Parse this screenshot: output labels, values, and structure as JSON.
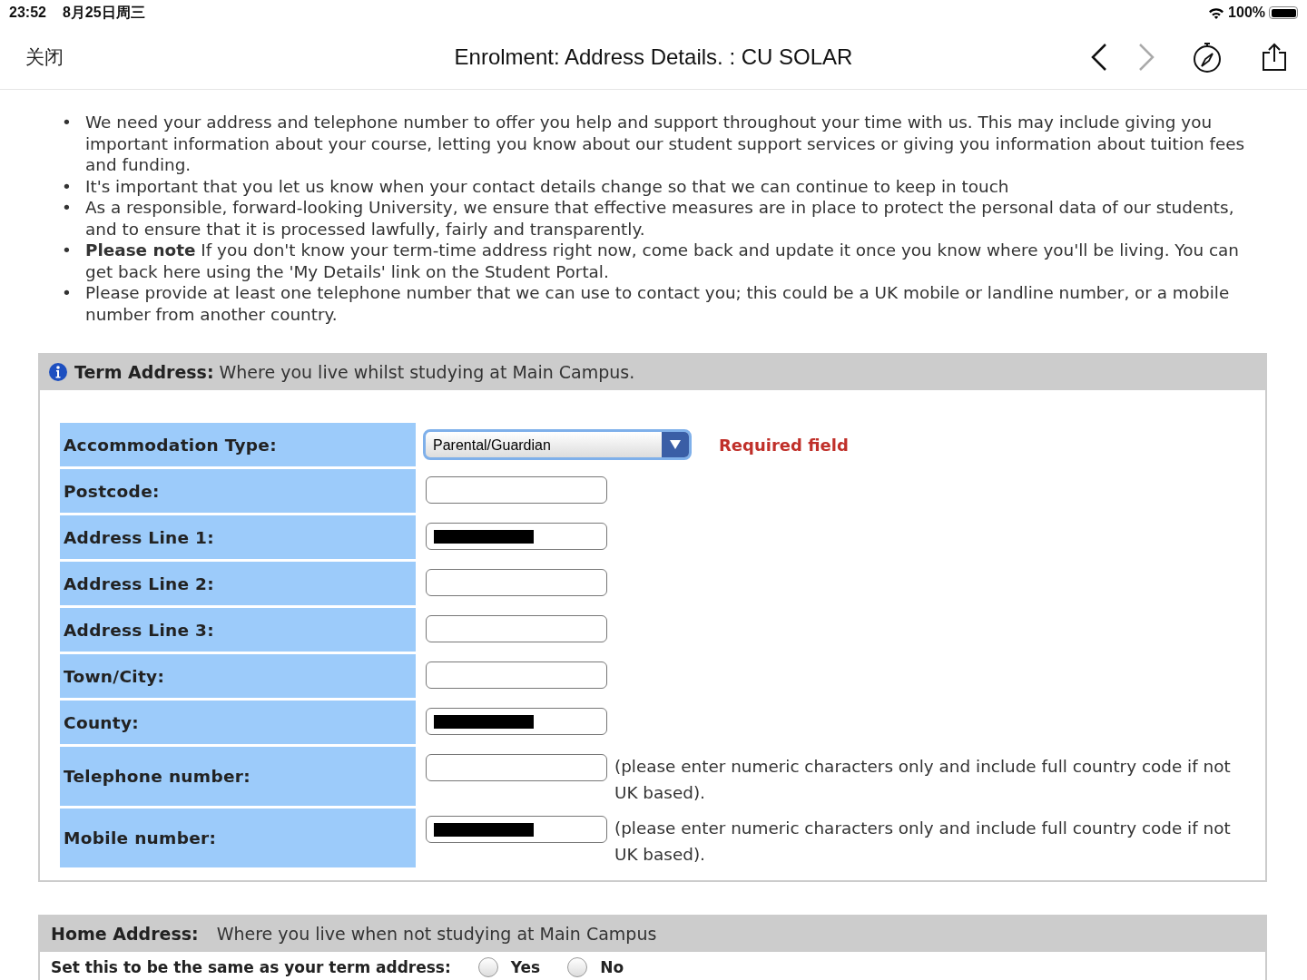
{
  "status_bar": {
    "time": "23:52",
    "date": "8月25日周三",
    "battery": "100%"
  },
  "nav": {
    "close": "关闭",
    "title": "Enrolment: Address Details. : CU SOLAR",
    "back_enabled": true,
    "forward_enabled": false
  },
  "bullets": [
    {
      "marker": "•",
      "text": "We need your address and telephone number to offer you help and support throughout your time with us. This may include giving you important information about your course, letting you know about our student support services or giving you information about tuition fees and funding."
    },
    {
      "marker": "•",
      "text": "It's important that you let us know when your contact details change so that we can continue to keep in touch"
    },
    {
      "marker": "•",
      "text": "As a responsible, forward-looking University, we ensure that effective measures are in place to protect the personal data of our students, and to ensure that it is processed lawfully, fairly and transparently."
    },
    {
      "marker": "•",
      "text": "**Please note** If you don't know your term-time address right now, come back and update it once you know where you'll be living. You can get back here using the 'My Details' link on the Student Portal."
    },
    {
      "marker": "•",
      "text": "Please provide at least one telephone number that we can use to contact you; this could be a UK mobile or landline number, or a mobile number from another country."
    }
  ],
  "term_address": {
    "title": "Term Address:",
    "subtitle": "Where you live whilst studying at Main Campus.",
    "rows": [
      {
        "kind": "select",
        "label": "Accommodation Type:",
        "value": "Parental/Guardian",
        "note": "Required field"
      },
      {
        "kind": "text",
        "label": "Postcode:",
        "redacted": false
      },
      {
        "kind": "text",
        "label": "Address Line 1:",
        "redacted": true
      },
      {
        "kind": "text",
        "label": "Address Line 2:",
        "redacted": false
      },
      {
        "kind": "text",
        "label": "Address Line 3:",
        "redacted": false
      },
      {
        "kind": "text",
        "label": "Town/City:",
        "redacted": false
      },
      {
        "kind": "text",
        "label": "County:",
        "redacted": true
      },
      {
        "kind": "text",
        "label": "Telephone number:",
        "redacted": false,
        "hint": "(please enter numeric characters only and include full country code if not UK based)."
      },
      {
        "kind": "text",
        "label": "Mobile number:",
        "redacted": true,
        "hint": "(please enter numeric characters only and include full country code if not UK based)."
      }
    ]
  },
  "home_address": {
    "title": "Home Address:",
    "subtitle": "Where you live when not studying at Main Campus",
    "question": "Set this to be the same as your term address:",
    "options": [
      {
        "label": "Yes",
        "selected": false
      },
      {
        "label": "No",
        "selected": false
      }
    ]
  }
}
